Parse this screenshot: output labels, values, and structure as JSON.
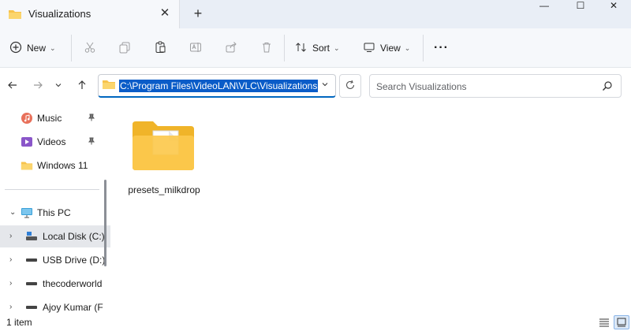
{
  "window": {
    "tab_title": "Visualizations",
    "tab_close_glyph": "✕",
    "new_tab_glyph": "+",
    "minimize_glyph": "—",
    "maximize_glyph": "☐",
    "close_glyph": "✕"
  },
  "toolbar": {
    "new_label": "New",
    "sort_label": "Sort",
    "view_label": "View",
    "more_glyph": "···",
    "chevron_glyph": "⌄"
  },
  "address": {
    "path": "C:\\Program Files\\VideoLAN\\VLC\\Visualizations",
    "dropdown_glyph": "⌄"
  },
  "search": {
    "placeholder": "Search Visualizations"
  },
  "sidebar": {
    "pin_glyph": "📌",
    "chevron_glyph": "›",
    "expanded_glyph": "⌄",
    "quick_access": [
      {
        "label": "Music",
        "pinned": true
      },
      {
        "label": "Videos",
        "pinned": true
      },
      {
        "label": "Windows 11",
        "pinned": false
      }
    ],
    "this_pc": {
      "label": "This PC"
    },
    "drives": [
      {
        "label": "Local Disk (C:)",
        "selected": true
      },
      {
        "label": "USB Drive (D:)",
        "selected": false
      },
      {
        "label": "thecoderworld",
        "selected": false
      },
      {
        "label": "Ajoy Kumar (F",
        "selected": false
      }
    ]
  },
  "content": {
    "items": [
      {
        "name": "presets_milkdrop",
        "type": "folder"
      }
    ]
  },
  "status": {
    "item_count": "1 item"
  },
  "colors": {
    "accent": "#0067c0",
    "selection_highlight": "#0a5cc8",
    "folder_yellow": "#f7c34d"
  }
}
